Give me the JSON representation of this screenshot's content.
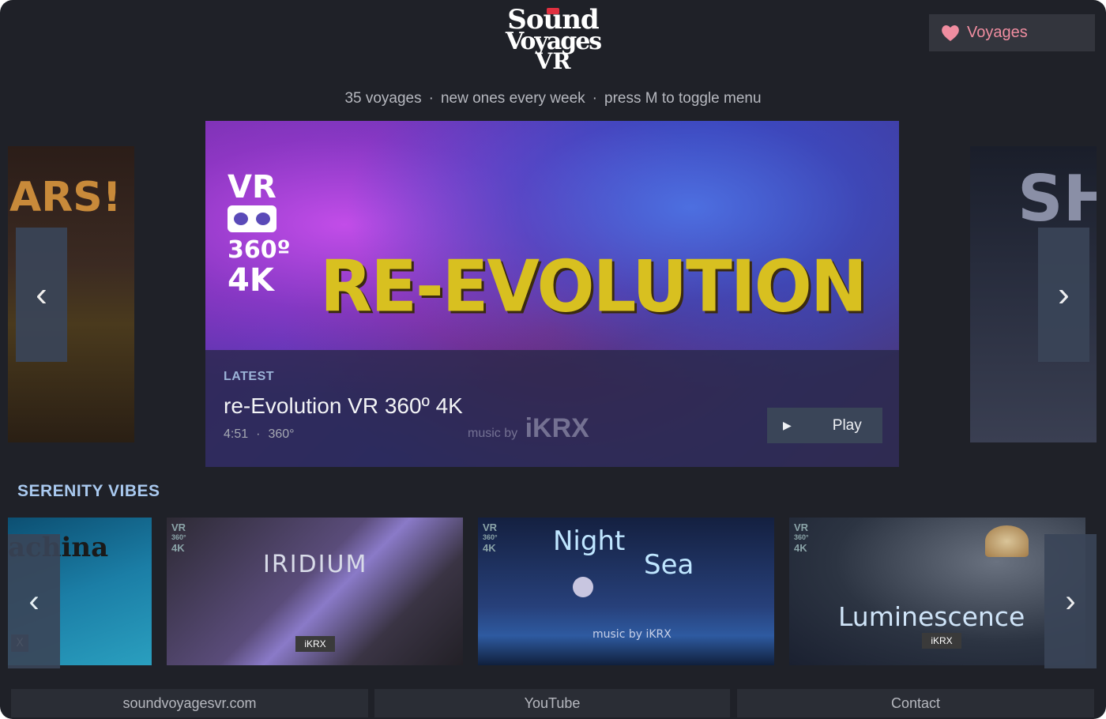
{
  "logo": {
    "line1": "Sound",
    "line2": "Voyages",
    "line3": "VR"
  },
  "header": {
    "count": "35 voyages",
    "update": "new ones every week",
    "hint": "press M to toggle menu",
    "separator": "·"
  },
  "favorites": {
    "icon": "heart-icon",
    "label": "Voyages",
    "color": "#f08da0"
  },
  "carousel": {
    "left_peek_text": "ARS!",
    "right_peek_text": "SH",
    "prev_icon": "chevron-left-icon",
    "next_icon": "chevron-right-icon",
    "prev_glyph": "‹",
    "next_glyph": "›"
  },
  "hero": {
    "badge_vr": "VR",
    "badge_deg": "360º",
    "badge_res": "4K",
    "art_title": "RE-EVOLUTION",
    "tag": "LATEST",
    "title": "re-Evolution VR 360º 4K",
    "duration": "4:51",
    "meta_sep": "·",
    "format": "360°",
    "watermark_small": "music by",
    "watermark_brand": "iKRX",
    "play_label": "Play",
    "play_icon": "play-icon"
  },
  "section": {
    "title": "SERENITY VIBES",
    "tiles": [
      {
        "caption": "achina",
        "close": "X"
      },
      {
        "caption": "IRIDIUM",
        "badge": "iKRX",
        "vr": "VR",
        "deg": "360°",
        "res": "4K"
      },
      {
        "caption1": "Night",
        "caption2": "Sea",
        "badge": "music by iKRX",
        "vr": "VR",
        "deg": "360°",
        "res": "4K"
      },
      {
        "caption": "Luminescence",
        "badge": "iKRX",
        "vr": "VR",
        "deg": "360°",
        "res": "4K"
      }
    ]
  },
  "footer": {
    "website": "soundvoyagesvr.com",
    "youtube": "YouTube",
    "contact": "Contact"
  },
  "colors": {
    "background": "#1f2128",
    "accent_button": "#3a4558",
    "section_title": "#a9c9ef",
    "hero_art_title": "#d8c020"
  }
}
